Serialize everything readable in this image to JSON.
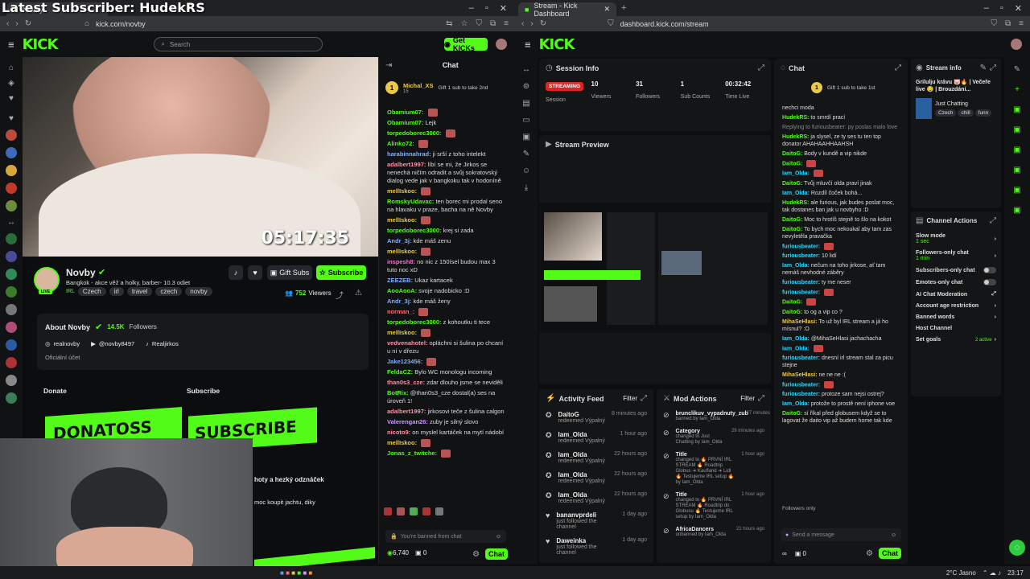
{
  "overlay": {
    "title": "Latest Subscriber: HudekRS"
  },
  "left_browser": {
    "address": "kick.com/novby",
    "search_placeholder": "Search",
    "get_kicks": "Get KICKs",
    "timer": "05:17:35",
    "channel": {
      "name": "Novby",
      "description": "Bangkok -  akce věž a holky, barber- 10.3 odiet",
      "tags": [
        "IRL",
        "Czech",
        "irl",
        "travel",
        "czech",
        "novby"
      ],
      "viewers": "752",
      "viewers_label": "Viewers",
      "gift_subs": "Gift Subs",
      "subscribe": "Subscribe"
    },
    "about": {
      "title": "About Novby",
      "followers": "14.5K",
      "followers_label": "Followers",
      "socials": [
        "realnovby",
        "@novby8497",
        "Realjirkos"
      ],
      "official": "Oficiální účet"
    },
    "donate_label": "Donate",
    "subscribe_label": "Subscribe",
    "donate_banner": "DONATOSS",
    "subscribe_banner": "SUBSCRIBE",
    "extra_text1": "hoty a hezký odznáček",
    "extra_text2": "moc koupit jachtu, diky",
    "chat": {
      "title": "Chat",
      "pinned_user": "Michal_XS",
      "pinned_count": "15",
      "pinned_text": "Gift 1 sub to take 2nd",
      "messages": [
        {
          "u": "Obamium07:",
          "t": "",
          "c": "#53fc18"
        },
        {
          "u": "Obamium07:",
          "t": "Lejk",
          "c": "#53fc18"
        },
        {
          "u": "torpedoborec3000:",
          "t": "",
          "c": "#53fc18"
        },
        {
          "u": "Alinko72:",
          "t": "",
          "c": "#53fc18"
        },
        {
          "u": "harabinnahrad:",
          "t": "ji srší z toho intelekt",
          "c": "#7fb0ff"
        },
        {
          "u": "adalbert1997:",
          "t": "líbí se mi, že Jirkos se nenechá ničím odradit a svůj sokratovský dialog vede jak v bangkoku tak v hodoníně",
          "c": "#ff8fa3"
        },
        {
          "u": "mellIskoo:",
          "t": "",
          "c": "#e8c94a"
        },
        {
          "u": "RomskyUdavac:",
          "t": "ten borec mi prodal seno na hlavaku v praze, bacha na ně Novby",
          "c": "#53fc18"
        },
        {
          "u": "mellIskoo:",
          "t": "",
          "c": "#e8c94a"
        },
        {
          "u": "torpedoborec3000:",
          "t": "krej si zada",
          "c": "#53fc18"
        },
        {
          "u": "Andr_3j:",
          "t": "kde máš zenu",
          "c": "#7fb0ff"
        },
        {
          "u": "mellIskoo:",
          "t": "",
          "c": "#e8c94a"
        },
        {
          "u": "inspesh8:",
          "t": "no nic z 150ísel budou max 3 tuto noc xD",
          "c": "#ff6ad5"
        },
        {
          "u": "ZEEZEB:",
          "t": "Ukaz kartacek",
          "c": "#7fb0ff"
        },
        {
          "u": "AooAooA:",
          "t": "svoje nadobicko :D",
          "c": "#53fc18"
        },
        {
          "u": "Andr_3j:",
          "t": "kde máš ženy",
          "c": "#7fb0ff"
        },
        {
          "u": "norman_:",
          "t": "",
          "c": "#ff6a6a"
        },
        {
          "u": "torpedoborec3000:",
          "t": "z kohoutku ti tece",
          "c": "#53fc18"
        },
        {
          "u": "mellIskoo:",
          "t": "",
          "c": "#e8c94a"
        },
        {
          "u": "vedvenahotel:",
          "t": "opláchni si šulina po chcaní u ní v dřezu",
          "c": "#ff8fa3"
        },
        {
          "u": "Jake123456:",
          "t": "",
          "c": "#7fb0ff"
        },
        {
          "u": "FeldaCZ:",
          "t": "Bylo WC monologu incoming",
          "c": "#53fc18"
        },
        {
          "u": "than0s3_cze:",
          "t": "zdar dlouho jsme se neviděli",
          "c": "#ff8fa3"
        },
        {
          "u": "BotRix:",
          "t": "@than0s3_cze dostal(a) ses na úroveň 1!",
          "c": "#53fc18"
        },
        {
          "u": "adalbert1997:",
          "t": "jirkosovi teče z šulina calgon",
          "c": "#ff8fa3"
        },
        {
          "u": "Valerengan26:",
          "t": "zuby je silný slovo",
          "c": "#c89bff"
        },
        {
          "u": "nicoto9:",
          "t": "on myslel kartáček na mytí nádobí",
          "c": "#ff8fa3"
        },
        {
          "u": "mellIskoo:",
          "t": "",
          "c": "#e8c94a"
        },
        {
          "u": "Jonas_z_twitche:",
          "t": "",
          "c": "#53fc18"
        }
      ],
      "banned_placeholder": "You're banned from chat",
      "kicks": "6,740",
      "zero": "0",
      "send": "Chat"
    }
  },
  "right_browser": {
    "tab_title": "Stream - Kick Dashboard",
    "address": "dashboard.kick.com/stream",
    "session": {
      "title": "Session Info",
      "status": "STREAMING",
      "status_label": "Session",
      "stats": [
        {
          "v": "10",
          "l": "Viewers"
        },
        {
          "v": "31",
          "l": "Followers"
        },
        {
          "v": "1",
          "l": "Sub Counts"
        },
        {
          "v": "00:32:42",
          "l": "Time Live"
        }
      ]
    },
    "preview_title": "Stream Preview",
    "activity": {
      "title": "Activity Feed",
      "filter": "Filter",
      "items": [
        {
          "n": "DaitoG",
          "d": "redeemed Výpalný",
          "t": "8 minutes ago",
          "icon": "redeem-icon"
        },
        {
          "n": "Iam_Olda",
          "d": "redeemed Výpalný",
          "t": "1 hour ago",
          "icon": "redeem-icon"
        },
        {
          "n": "Iam_Olda",
          "d": "redeemed Výpalný",
          "t": "22 hours ago",
          "icon": "redeem-icon"
        },
        {
          "n": "Iam_Olda",
          "d": "redeemed Výpalný",
          "t": "22 hours ago",
          "icon": "redeem-icon"
        },
        {
          "n": "Iam_Olda",
          "d": "redeemed Výpalný",
          "t": "22 hours ago",
          "icon": "redeem-icon"
        },
        {
          "n": "bananvprdeli",
          "d": "just followed the channel",
          "t": "1 day ago",
          "icon": "heart-icon"
        },
        {
          "n": "Daweinka",
          "d": "just followed the channel",
          "t": "1 day ago",
          "icon": "heart-icon"
        }
      ]
    },
    "mod": {
      "title": "Mod Actions",
      "filter": "Filter",
      "items": [
        {
          "n": "brunclikuv_vypadnuty_zub",
          "d": "banned by Iam_Olda",
          "t": "27 minutes ago"
        },
        {
          "n": "Category",
          "d": "changed to Just Chatting by Iam_Olda",
          "t": "29 minutes ago"
        },
        {
          "n": "Title",
          "d": "changed to 🔥 PRVNÍ IRL STREAM 🔥 Roadtrip Globus ➜ Kaufland ➜ Lidl 🔥 Testujeme IRL setup 🔥 by Iam_Olda",
          "t": "1 hour ago"
        },
        {
          "n": "Title",
          "d": "changed to 🔥 PRVNÍ IRL STREAM 🔥 Roadtrip do Globusu 🔥 Testujeme IRL setup by Iam_Olda",
          "t": "1 hour ago"
        },
        {
          "n": "AfricaDancers",
          "d": "unbanned by Iam_Olda",
          "t": "21 hours ago"
        }
      ]
    },
    "chat": {
      "title": "Chat",
      "pinned_text": "Gift 1 sub to take 1st",
      "messages": [
        {
          "u": "",
          "t": "nechci moda",
          "c": "#ddd"
        },
        {
          "u": "HudekRS:",
          "t": "to smrdí prací",
          "c": "#53fc18"
        },
        {
          "u": "",
          "t": "Replying to furiousbeater: py poslas malo love",
          "c": "#888"
        },
        {
          "u": "HudekRS:",
          "t": "ja slysel, ze ty ses tu ten top donator AHAHAAHHAAHSH",
          "c": "#53fc18"
        },
        {
          "u": "DaitoG:",
          "t": "Body v kundě a vip nikde",
          "c": "#53fc18"
        },
        {
          "u": "DaitoG:",
          "t": "",
          "c": "#53fc18"
        },
        {
          "u": "Iam_Olda:",
          "t": "",
          "c": "#2fd6ff"
        },
        {
          "u": "DaitoG:",
          "t": "Tvůj mluvčí olda praví jinak",
          "c": "#53fc18"
        },
        {
          "u": "Iam_Olda:",
          "t": "Rozdíl čoček bohá...",
          "c": "#2fd6ff"
        },
        {
          "u": "HudekRS:",
          "t": "ale furious, jak budes poslat moc, tak dostanes ban jak u novbyho :D",
          "c": "#53fc18"
        },
        {
          "u": "DaitoG:",
          "t": "Moc to hrotíš stejně to šlo na kokot",
          "c": "#53fc18"
        },
        {
          "u": "DaitoG:",
          "t": "To bych moc nekoukal aby tam zas nevyletěla pravačka",
          "c": "#53fc18"
        },
        {
          "u": "furiousbeater:",
          "t": "",
          "c": "#2fd6ff"
        },
        {
          "u": "furiousbeater:",
          "t": "10 lidí",
          "c": "#2fd6ff"
        },
        {
          "u": "Iam_Olda:",
          "t": "nečum na toho jirkose, ať tam nemáš nevhodné záběry",
          "c": "#2fd6ff"
        },
        {
          "u": "furiousbeater:",
          "t": "ty me neser",
          "c": "#2fd6ff"
        },
        {
          "u": "furiousbeater:",
          "t": "",
          "c": "#2fd6ff"
        },
        {
          "u": "DaitoG:",
          "t": "",
          "c": "#53fc18"
        },
        {
          "u": "DaitoG:",
          "t": "to og a vip co ?",
          "c": "#53fc18"
        },
        {
          "u": "MihaSeHlasi:",
          "t": "To už byl IRL stream a já ho mísnul? :O",
          "c": "#e8c94a"
        },
        {
          "u": "Iam_Olda:",
          "t": "@MihaSeHlasi jachachacha",
          "c": "#2fd6ff"
        },
        {
          "u": "Iam_Olda:",
          "t": "",
          "c": "#2fd6ff"
        },
        {
          "u": "furiousbeater:",
          "t": "dnesní irl stream stal za picu stejne",
          "c": "#2fd6ff"
        },
        {
          "u": "MihaSeHlasi:",
          "t": "ne ne ne :(",
          "c": "#e8c94a"
        },
        {
          "u": "furiousbeater:",
          "t": "",
          "c": "#2fd6ff"
        },
        {
          "u": "furiousbeater:",
          "t": "protoze sam nejsi ostrej?",
          "c": "#2fd6ff"
        },
        {
          "u": "Iam_Olda:",
          "t": "protože to prostě není iphone voe",
          "c": "#2fd6ff"
        },
        {
          "u": "DaitoG:",
          "t": "sí říkal před globusem když se to lagovat že daito vip až budem home tak kde",
          "c": "#53fc18"
        }
      ],
      "followers_only": "Followers only",
      "placeholder": "Send a message",
      "zero": "0",
      "send": "Chat"
    },
    "stream_info": {
      "title": "Stream info",
      "stream_title": "Grilulju krávu 🐷🔥 | Večeře live 🤤 | Brouzdání...",
      "category": "Just Chatting",
      "tags": [
        "Czech",
        "chill",
        "funn"
      ]
    },
    "channel_actions": {
      "title": "Channel Actions",
      "items": [
        {
          "label": "Slow mode",
          "sub": "1 sec",
          "kind": "arrow"
        },
        {
          "label": "Followers-only chat",
          "sub": "1 min",
          "kind": "arrow"
        },
        {
          "label": "Subscribers-only chat",
          "sub": "",
          "kind": "toggle"
        },
        {
          "label": "Emotes-only chat",
          "sub": "",
          "kind": "toggle"
        },
        {
          "label": "AI Chat Moderation",
          "sub": "",
          "kind": "ext"
        },
        {
          "label": "Account age restriction",
          "sub": "",
          "kind": "arrow"
        },
        {
          "label": "Banned words",
          "sub": "",
          "kind": "arrow"
        },
        {
          "label": "Host Channel",
          "sub": "",
          "kind": "none"
        },
        {
          "label": "Set goals",
          "sub": "",
          "kind": "arrow",
          "badge": "2 active"
        }
      ]
    }
  },
  "taskbar": {
    "weather": "2°C  Jasno",
    "time": "23:17"
  },
  "colors": {
    "accent": "#53fc18",
    "bg": "#0b0d0e",
    "panel": "#141517"
  }
}
